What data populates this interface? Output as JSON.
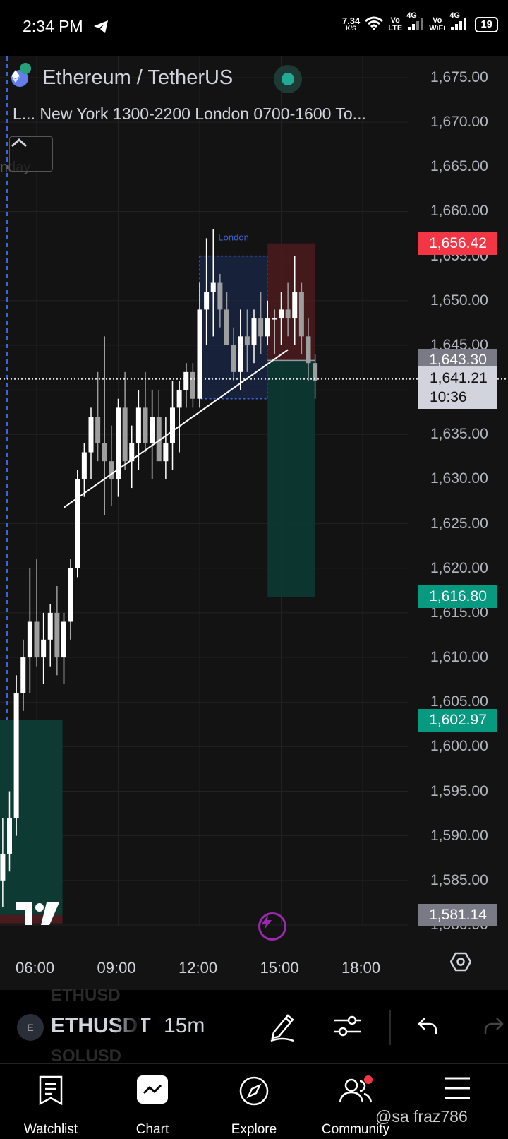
{
  "status_bar": {
    "time": "2:34 PM",
    "net_speed": "7.34",
    "net_unit": "K/S",
    "sim1_top": "Vo",
    "sim1_bottom": "LTE",
    "sim1_type": "4G",
    "sim2_top": "Vo",
    "sim2_bottom": "WiFi",
    "sim2_type": "4G",
    "battery": "19",
    "icons": [
      "telegram-icon",
      "wifi-icon",
      "signal-icon",
      "battery-icon"
    ]
  },
  "chart_header": {
    "title": "Ethereum / TetherUS",
    "indicator": "L... New York 1300-2200 London 0700-1600 To...",
    "day_label": "nday",
    "session_label": "London"
  },
  "axis": {
    "y_ticks": [
      "1,675.00",
      "1,670.00",
      "1,665.00",
      "1,660.00",
      "1,655.00",
      "1,650.00",
      "1,645.00",
      "1,640.00",
      "1,635.00",
      "1,630.00",
      "1,625.00",
      "1,620.00",
      "1,615.00",
      "1,610.00",
      "1,605.00",
      "1,600.00",
      "1,595.00",
      "1,590.00",
      "1,585.00",
      "1,580.00"
    ],
    "x_ticks": [
      "06:00",
      "09:00",
      "12:00",
      "15:00",
      "18:00"
    ]
  },
  "price_labels": {
    "stop": "1,656.42",
    "entry": "1,643.30",
    "current_price": "1,641.21",
    "countdown": "10:36",
    "target": "1,616.80",
    "other_target": "1,602.97",
    "bottom": "1,581.14"
  },
  "colors": {
    "background": "#131313",
    "bull": "#ffffff",
    "bear": "#9e9e9e",
    "stop_zone": "#4a1b1e",
    "target_zone": "#0d3a33",
    "session_box": "#1a2b55",
    "accent_red": "#f23645",
    "accent_green": "#089981"
  },
  "chart_data": {
    "type": "candlestick",
    "symbol": "ETHUSDT",
    "interval": "15m",
    "ylim": [
      1580,
      1677
    ],
    "x_ticks": [
      "06:00",
      "09:00",
      "12:00",
      "15:00",
      "18:00"
    ],
    "x_ticks_time_h": [
      6,
      9,
      12,
      15,
      18
    ],
    "candle_minutes": 15,
    "first_candle_time_h": 4.75,
    "ohlc": [
      [
        1585,
        1592,
        1582,
        1588
      ],
      [
        1588,
        1595,
        1586,
        1592
      ],
      [
        1592,
        1608,
        1590,
        1606
      ],
      [
        1606,
        1612,
        1604,
        1610
      ],
      [
        1610,
        1620,
        1606,
        1614
      ],
      [
        1614,
        1621,
        1609,
        1610
      ],
      [
        1610,
        1615,
        1607,
        1612
      ],
      [
        1612,
        1616,
        1609,
        1615
      ],
      [
        1615,
        1618,
        1608,
        1610
      ],
      [
        1610,
        1615,
        1607,
        1614
      ],
      [
        1614,
        1621,
        1612,
        1620
      ],
      [
        1620,
        1631,
        1619,
        1630
      ],
      [
        1630,
        1634,
        1628,
        1633
      ],
      [
        1633,
        1638,
        1630,
        1637
      ],
      [
        1637,
        1642,
        1632,
        1634
      ],
      [
        1634,
        1646,
        1626,
        1632
      ],
      [
        1632,
        1636,
        1627,
        1630
      ],
      [
        1630,
        1639,
        1628,
        1638
      ],
      [
        1638,
        1642,
        1631,
        1632
      ],
      [
        1632,
        1636,
        1629,
        1634
      ],
      [
        1634,
        1640,
        1631,
        1638
      ],
      [
        1638,
        1642,
        1633,
        1634
      ],
      [
        1634,
        1640,
        1630,
        1637
      ],
      [
        1637,
        1640,
        1632,
        1632
      ],
      [
        1632,
        1637,
        1630,
        1634
      ],
      [
        1634,
        1641,
        1631,
        1638
      ],
      [
        1638,
        1641,
        1633,
        1640
      ],
      [
        1640,
        1643,
        1638,
        1642
      ],
      [
        1642,
        1643,
        1638,
        1639
      ],
      [
        1639,
        1652,
        1638,
        1649
      ],
      [
        1649,
        1657,
        1645,
        1651
      ],
      [
        1651,
        1658,
        1646,
        1652
      ],
      [
        1652,
        1653,
        1647,
        1649
      ],
      [
        1649,
        1651,
        1645,
        1645
      ],
      [
        1645,
        1647,
        1641,
        1642
      ],
      [
        1642,
        1649,
        1640,
        1646
      ],
      [
        1646,
        1649,
        1642,
        1645
      ],
      [
        1645,
        1649,
        1643,
        1648
      ],
      [
        1648,
        1651,
        1644,
        1646
      ],
      [
        1646,
        1650,
        1645,
        1648
      ],
      [
        1648,
        1649,
        1644,
        1648
      ],
      [
        1648,
        1651,
        1645,
        1649
      ],
      [
        1649,
        1652,
        1646,
        1648
      ],
      [
        1648,
        1655,
        1645,
        1651
      ],
      [
        1651,
        1652,
        1644,
        1646
      ],
      [
        1646,
        1648,
        1641,
        1643
      ],
      [
        1643,
        1644,
        1639,
        1641
      ]
    ],
    "session_box": {
      "label": "London",
      "time_start_h": 12,
      "time_end_h": 14.5,
      "price_low": 1639,
      "price_high": 1655
    },
    "position": {
      "time_start_h": 14.5,
      "time_end_h": 16.25,
      "entry": 1643.3,
      "stop": 1656.42,
      "target": 1616.8
    },
    "old_position": {
      "time_start_h": 4.6,
      "time_end_h": 6.95,
      "entry": 1602.97,
      "target": 1581.14
    },
    "trendline": [
      [
        7.0,
        1626.8
      ],
      [
        15.25,
        1644.5
      ]
    ]
  },
  "toolbar": {
    "symbol": "ETHUSDT",
    "symbol_prev": "ETHUSD",
    "symbol_next": "SOLUSD",
    "symbol_icon_letter": "E",
    "interval": "15m",
    "tools": [
      "pencil-icon",
      "sliders-icon",
      "undo-icon",
      "redo-icon"
    ]
  },
  "nav": {
    "items": [
      {
        "label": "Watchlist"
      },
      {
        "label": "Chart"
      },
      {
        "label": "Explore"
      },
      {
        "label": "Community"
      },
      {
        "label": ""
      }
    ]
  },
  "watermark": "@sa  fraz786"
}
